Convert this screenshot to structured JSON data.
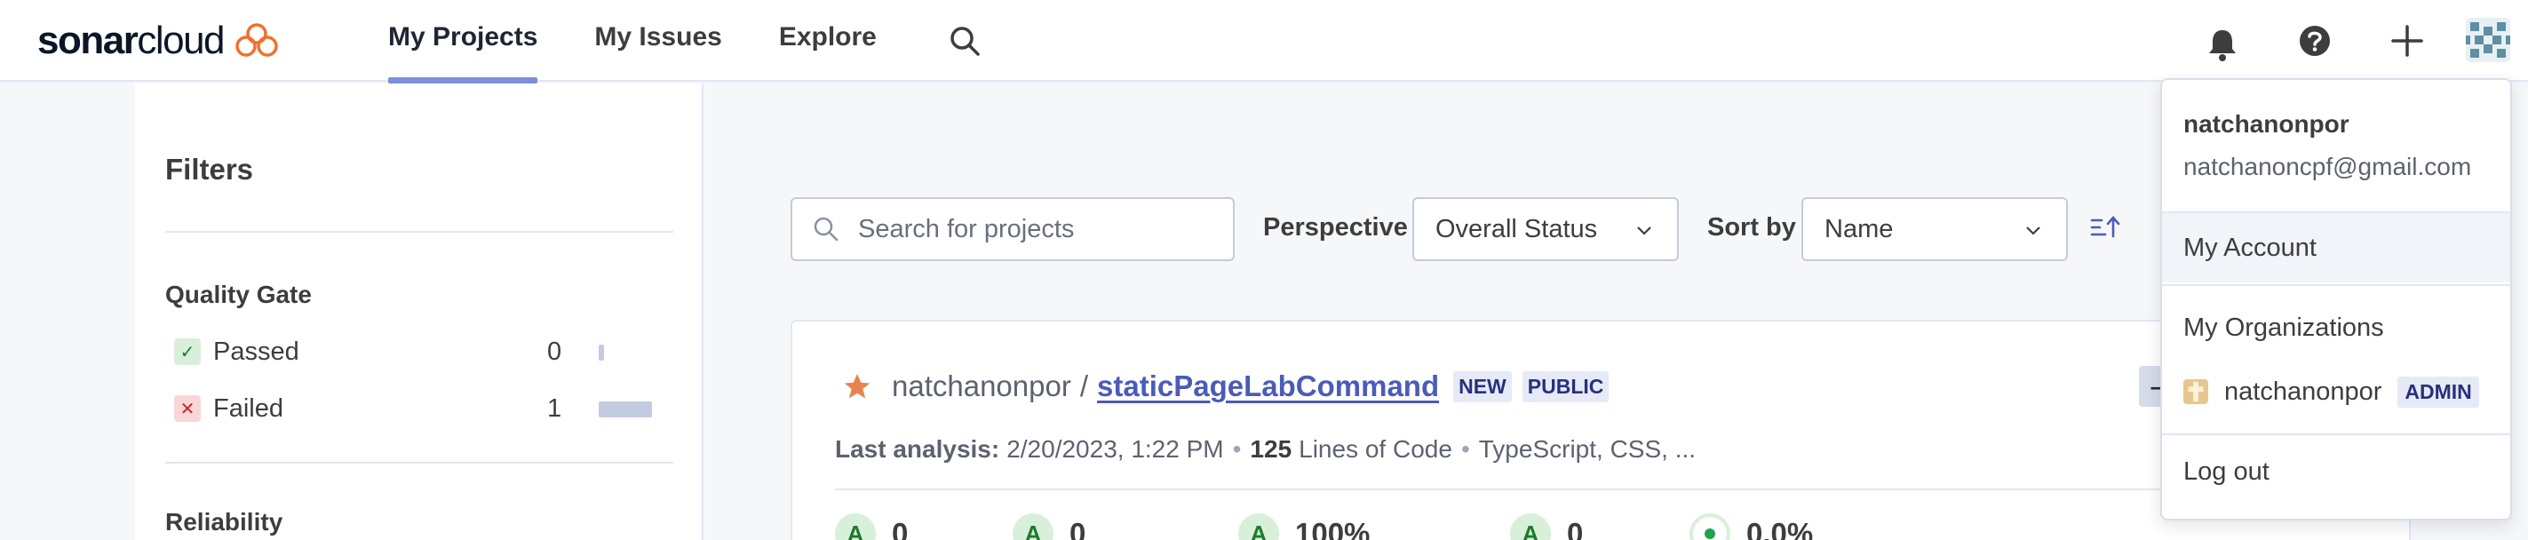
{
  "brand": {
    "name_bold": "sonar",
    "name_light": "cloud",
    "accent": "#f3702a"
  },
  "nav": {
    "items": [
      {
        "label": "My Projects",
        "active": true
      },
      {
        "label": "My Issues",
        "active": false
      },
      {
        "label": "Explore",
        "active": false
      }
    ],
    "search_icon": "search-icon",
    "right_icons": [
      "bell-icon",
      "help-icon",
      "plus-icon",
      "avatar"
    ]
  },
  "sidebar": {
    "title": "Filters",
    "quality_gate": {
      "title": "Quality Gate",
      "facets": [
        {
          "label": "Passed",
          "count": "0",
          "icon": "check-icon",
          "fraction": 0.0
        },
        {
          "label": "Failed",
          "count": "1",
          "icon": "cross-icon",
          "fraction": 1.0
        }
      ]
    },
    "next_section_title": "Reliability"
  },
  "toolbar": {
    "search_placeholder": "Search for projects",
    "perspective_label": "Perspective",
    "perspective_value": "Overall Status",
    "sort_label": "Sort by",
    "sort_value": "Name",
    "sort_direction_icon": "sort-ascending-icon"
  },
  "project": {
    "org": "natchanonpor",
    "separator": "/",
    "name": "staticPageLabCommand",
    "tags": [
      "NEW",
      "PUBLIC"
    ],
    "edge_button": "–",
    "last_analysis_label": "Last analysis:",
    "last_analysis_value": "2/20/2023, 1:22 PM",
    "dot": "•",
    "loc_value": "125",
    "loc_label": "Lines of Code",
    "languages": "TypeScript, CSS, ...",
    "metrics": [
      {
        "grade": "A",
        "value": "0"
      },
      {
        "grade": "A",
        "value": "0"
      },
      {
        "grade": "A",
        "value": "100%"
      },
      {
        "grade": "A",
        "value": "0"
      },
      {
        "grade": "",
        "value": "0.0%"
      }
    ]
  },
  "account_menu": {
    "username": "natchanonpor",
    "email": "natchanoncpf@gmail.com",
    "items": {
      "my_account": "My Account",
      "my_organizations": "My Organizations",
      "org_name": "natchanonpor",
      "org_role": "ADMIN",
      "logout": "Log out"
    }
  },
  "colors": {
    "nav_active_underline": "#7d8fd8",
    "link": "#4b5bb8",
    "grade_a_bg": "#d8f0da",
    "grade_a_fg": "#1f7a2c",
    "failed_bg": "#fbd6d6",
    "star": "#e8834f"
  }
}
